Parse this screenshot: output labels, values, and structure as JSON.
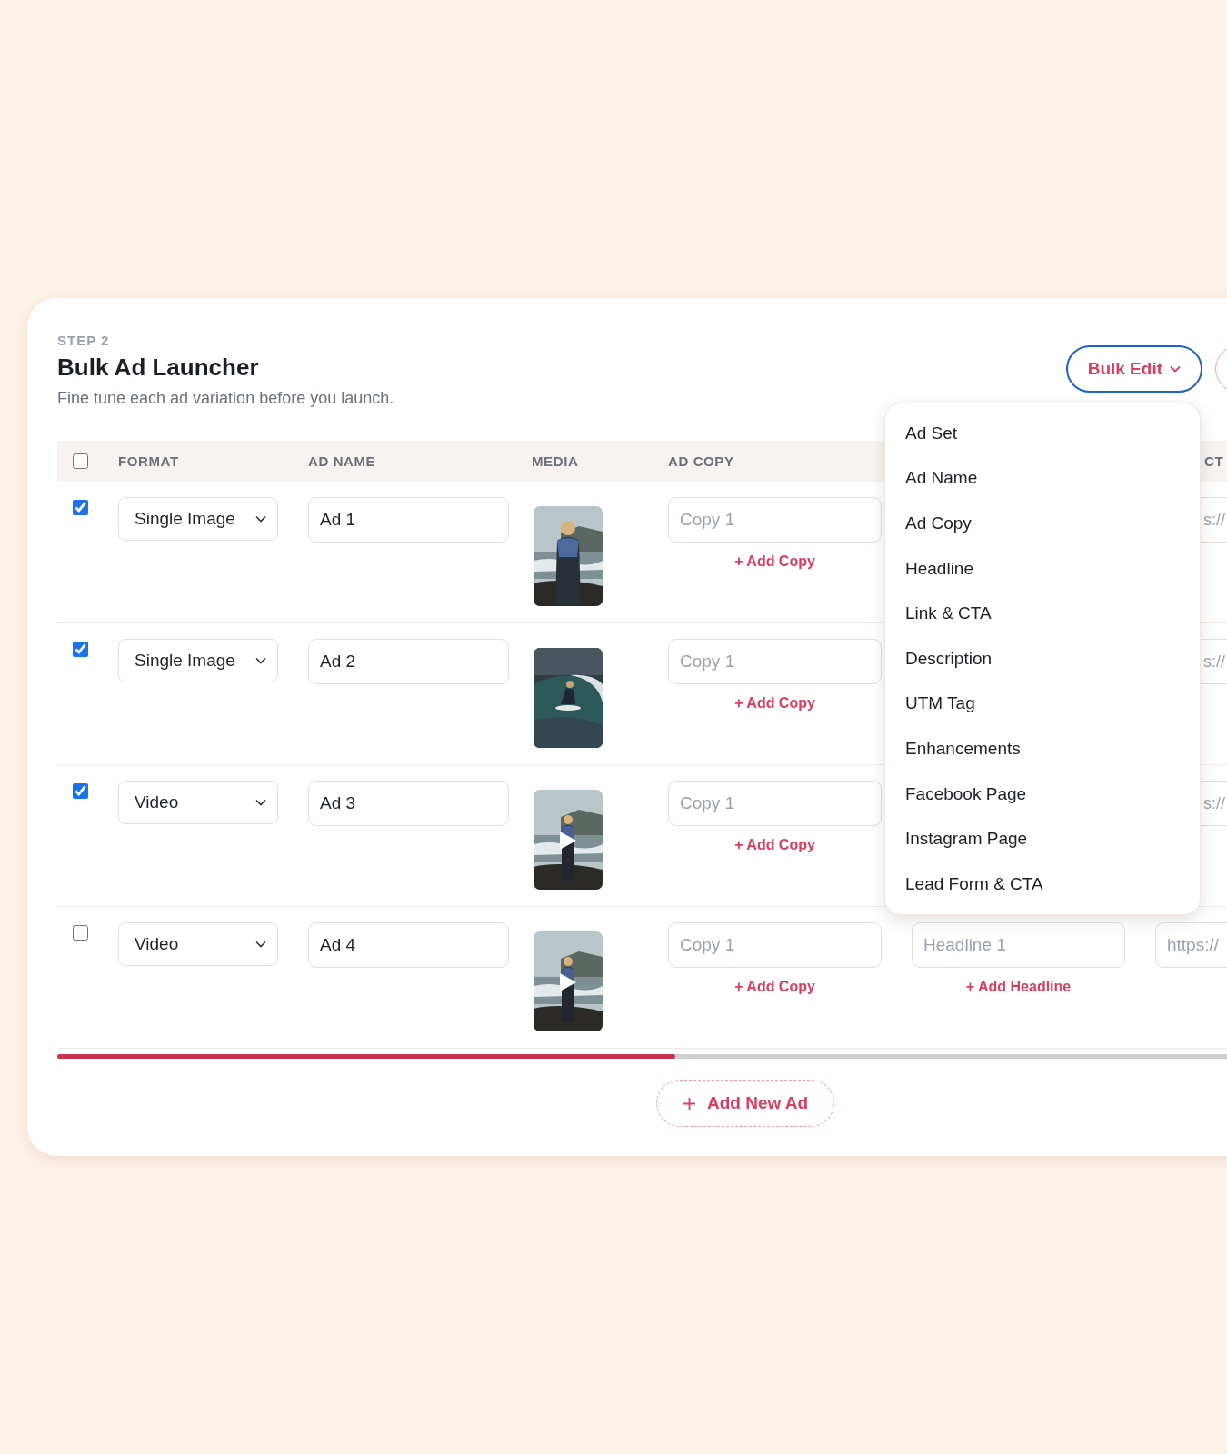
{
  "step": "STEP 2",
  "title": "Bulk Ad Launcher",
  "subtitle": "Fine tune each ad variation before you launch.",
  "bulk_edit": {
    "label": "Bulk Edit"
  },
  "bulk_edit_menu": [
    "Ad Set",
    "Ad Name",
    "Ad Copy",
    "Headline",
    "Link & CTA",
    "Description",
    "UTM Tag",
    "Enhancements",
    "Facebook Page",
    "Instagram Page",
    "Lead Form & CTA"
  ],
  "table": {
    "select_all": {
      "checked": false
    },
    "columns": [
      "FORMAT",
      "AD NAME",
      "MEDIA",
      "AD COPY",
      "CT"
    ],
    "rows": [
      {
        "checked": true,
        "format": "Single Image",
        "ad_name": "Ad 1",
        "video": false,
        "ad_copy_placeholder": "Copy 1",
        "add_copy": "+ Add Copy",
        "link_placeholder": "s://"
      },
      {
        "checked": true,
        "format": "Single Image",
        "ad_name": "Ad 2",
        "video": false,
        "ad_copy_placeholder": "Copy 1",
        "add_copy": "+ Add Copy",
        "link_placeholder": "s://"
      },
      {
        "checked": true,
        "format": "Video",
        "ad_name": "Ad 3",
        "video": true,
        "ad_copy_placeholder": "Copy 1",
        "add_copy": "+ Add Copy",
        "link_placeholder": "s://"
      },
      {
        "checked": false,
        "format": "Video",
        "ad_name": "Ad 4",
        "video": true,
        "ad_copy_placeholder": "Copy 1",
        "add_copy": "+ Add Copy",
        "headline_placeholder": "Headline 1",
        "add_headline": "+ Add Headline",
        "link_placeholder": "https://"
      }
    ]
  },
  "add_new_ad": "Add New Ad"
}
